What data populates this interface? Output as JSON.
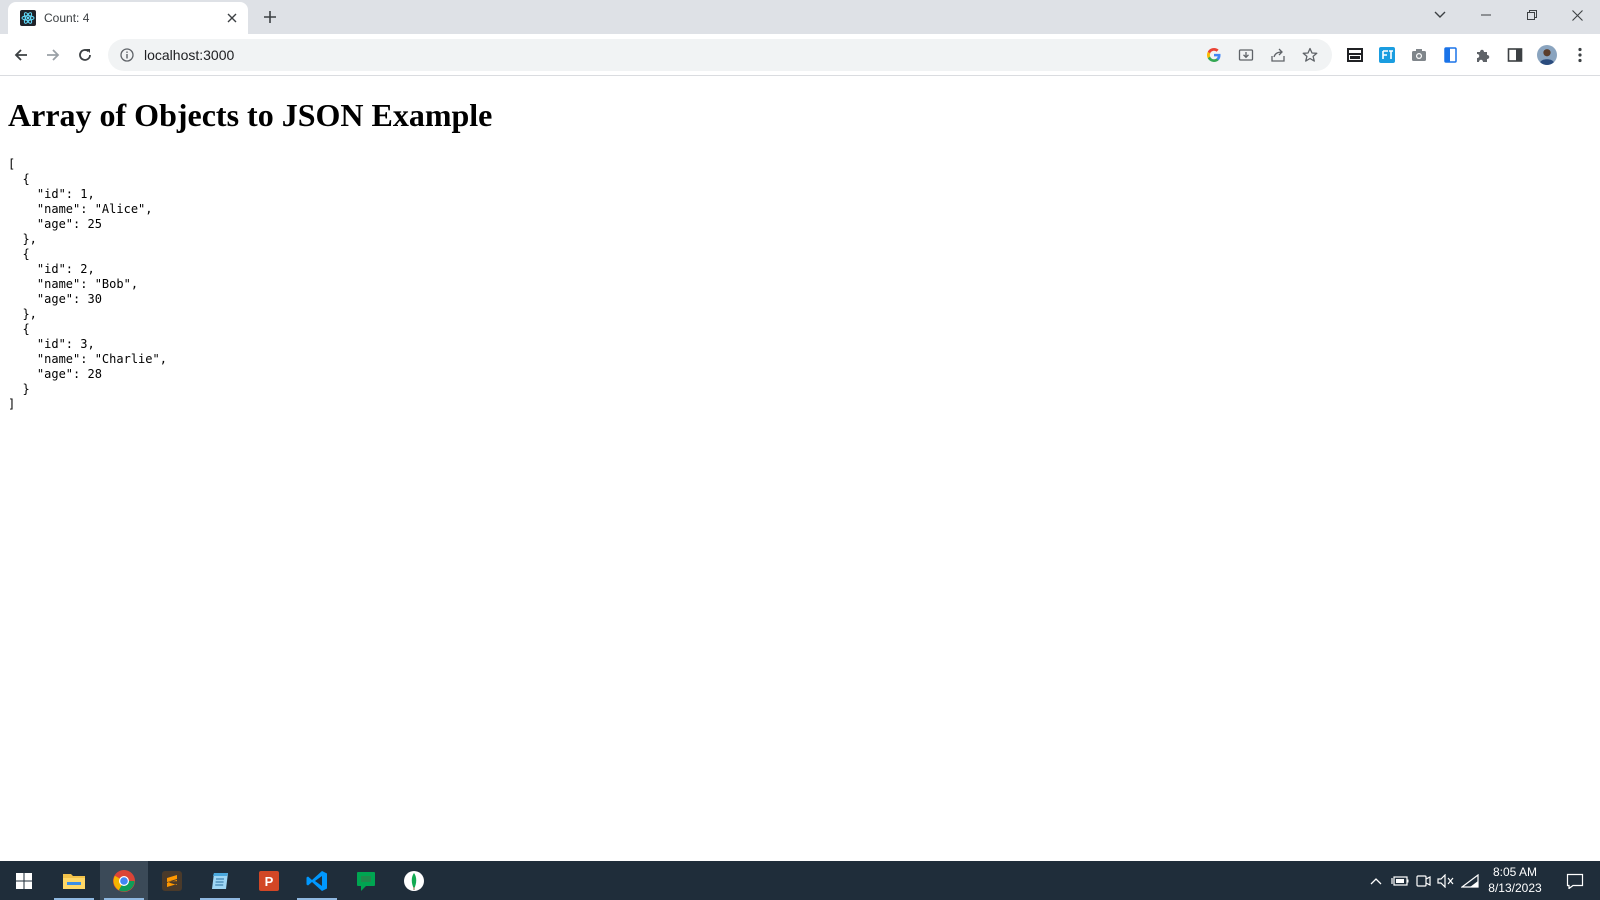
{
  "browser": {
    "tab": {
      "title": "Count: 4",
      "favicon": "react-icon"
    },
    "address_bar": {
      "url": "localhost:3000"
    },
    "icons": [
      "back-icon",
      "forward-icon",
      "reload-icon",
      "site-info-icon",
      "google-icon",
      "install-icon",
      "share-icon",
      "bookmark-star-icon",
      "news-extension-icon",
      "ft-extension-icon",
      "camera-extension-icon",
      "doc-extension-icon",
      "extensions-puzzle-icon",
      "side-panel-icon",
      "profile-avatar",
      "kebab-menu-icon"
    ]
  },
  "page": {
    "heading": "Array of Objects to JSON Example",
    "json_output": "[\n  {\n    \"id\": 1,\n    \"name\": \"Alice\",\n    \"age\": 25\n  },\n  {\n    \"id\": 2,\n    \"name\": \"Bob\",\n    \"age\": 30\n  },\n  {\n    \"id\": 3,\n    \"name\": \"Charlie\",\n    \"age\": 28\n  }\n]"
  },
  "taskbar": {
    "apps": [
      "file-explorer",
      "chrome",
      "sublime-text",
      "notepad",
      "powerpoint",
      "vscode",
      "chat-app",
      "mongodb-compass"
    ],
    "clock": {
      "time": "8:05 AM",
      "date": "8/13/2023"
    }
  },
  "colors": {
    "tabstrip": "#dee1e6",
    "taskbar": "#1f2d3a",
    "omnibox": "#f1f3f4"
  }
}
